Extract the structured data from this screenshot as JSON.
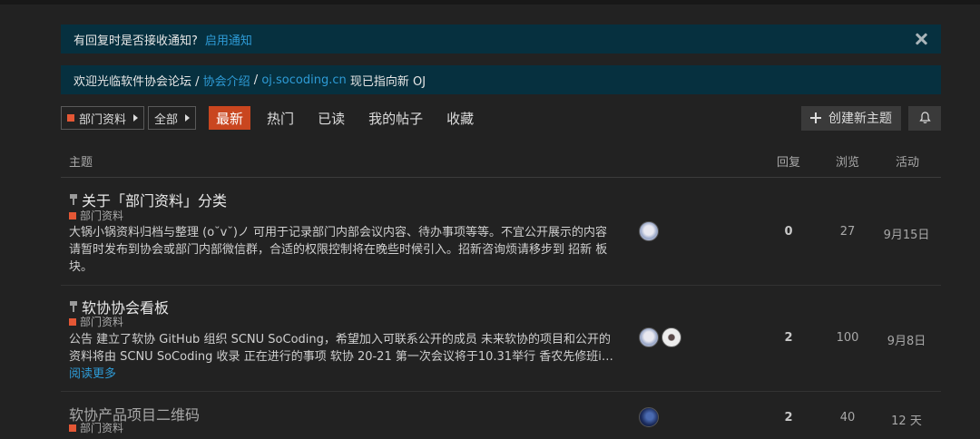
{
  "notify_banner": {
    "text": "有回复时是否接收通知?",
    "link": "启用通知"
  },
  "welcome_banner": {
    "prefix": "欢迎光临软件协会论坛 / ",
    "link1": "协会介绍",
    "sep": " / ",
    "link2": "oj.socoding.cn",
    "suffix": " 现已指向新 OJ"
  },
  "filters": {
    "category": "部门资料",
    "tags": "全部"
  },
  "tabs": [
    "最新",
    "热门",
    "已读",
    "我的帖子",
    "收藏"
  ],
  "actions": {
    "create": "创建新主题"
  },
  "table_header": {
    "topic": "主题",
    "replies": "回复",
    "views": "浏览",
    "activity": "活动"
  },
  "topics": [
    {
      "title": "关于「部门资料」分类",
      "category": "部门资料",
      "excerpt": "大锅小锅资料归档与整理 (o˘v˘)ノ 可用于记录部门内部会议内容、待办事项等等。不宜公开展示的内容请暂时发布到协会或部门内部微信群，合适的权限控制将在晚些时候引入。招新咨询烦请移步到 招新 板块。",
      "replies": "0",
      "views": "27",
      "activity": "9月15日"
    },
    {
      "title": "软协协会看板",
      "category": "部门资料",
      "excerpt": "公告 建立了软协 GitHub 组织 SCNU SoCoding，希望加入可联系公开的成员 未来软协的项目和公开的资料将由 SCNU SoCoding 收录 正在进行的事项 软协 20-21 第一次会议将于10.31举行 香农先修班i…",
      "readmore": "阅读更多",
      "replies": "2",
      "views": "100",
      "activity": "9月8日"
    },
    {
      "title": "软协产品项目二维码",
      "category": "部门资料",
      "replies": "2",
      "views": "40",
      "activity": "12 天"
    }
  ]
}
